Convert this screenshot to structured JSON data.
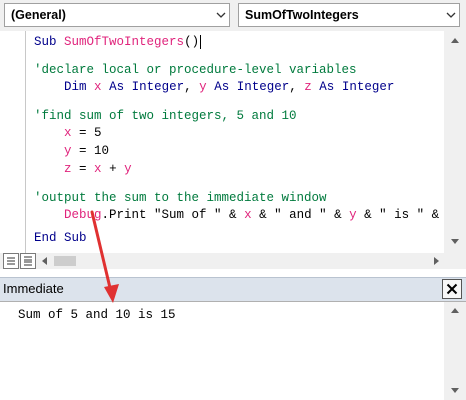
{
  "toolbar": {
    "object_combo": "(General)",
    "procedure_combo": "SumOfTwoIntegers"
  },
  "code": {
    "sub_kw": "Sub",
    "sub_name": "SumOfTwoIntegers",
    "sub_parens": "()",
    "comment1": "'declare local or procedure-level variables",
    "dim_kw": "Dim",
    "var_x": "x",
    "var_y": "y",
    "var_z": "z",
    "as_kw": "As",
    "integer_kw": "Integer",
    "comma": ",",
    "comment2": "'find sum of two integers, 5 and 10",
    "assign_x_value": " = 5",
    "assign_y_value": " = 10",
    "equals": " = ",
    "plus": " + ",
    "comment3": "'output the sum to the immediate window",
    "debug_obj": "Debug",
    "debug_method": ".Print",
    "print_str1": " \"Sum of \" & ",
    "amp_str2": " & \" and \" & ",
    "amp_str3": " & \" is \" & ",
    "end_sub": "End Sub"
  },
  "immediate": {
    "title": "Immediate",
    "output": "Sum of 5 and 10 is 15"
  },
  "colors": {
    "keyword": "#00008b",
    "identifier": "#e0247c",
    "comment": "#007a3d",
    "annotation_arrow": "#e03131"
  },
  "icons": {
    "dropdown": "chevron-down-icon",
    "close": "close-icon",
    "procedure_view": "procedure-view-icon",
    "module_view": "full-module-view-icon"
  }
}
